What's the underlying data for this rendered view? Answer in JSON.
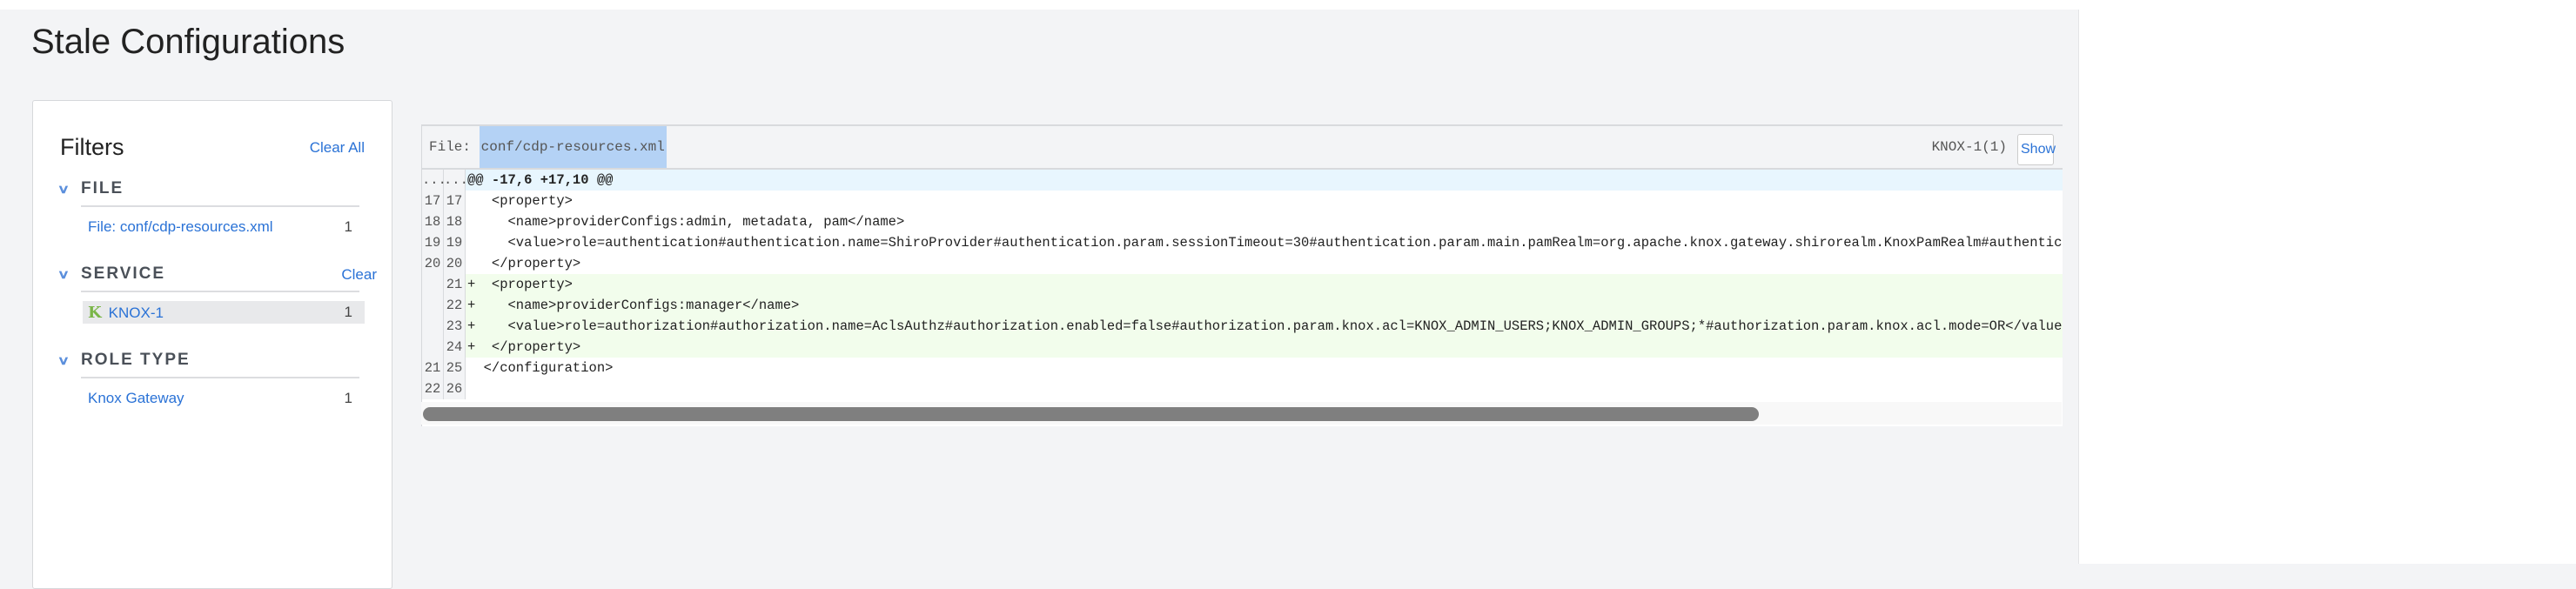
{
  "page": {
    "title": "Stale Configurations"
  },
  "filters": {
    "heading": "Filters",
    "clear_all": "Clear All",
    "sections": [
      {
        "title": "FILE",
        "items": [
          {
            "label": "File: conf/cdp-resources.xml",
            "count": "1"
          }
        ]
      },
      {
        "title": "SERVICE",
        "clear": "Clear",
        "items": [
          {
            "label": "KNOX-1",
            "count": "1",
            "icon": "knox-icon",
            "icon_text": "K"
          }
        ]
      },
      {
        "title": "ROLE TYPE",
        "items": [
          {
            "label": "Knox Gateway",
            "count": "1"
          }
        ]
      }
    ]
  },
  "diff": {
    "file_prefix": "File: ",
    "file_path": "conf/cdp-resources.xml",
    "service": "KNOX-1(1)",
    "show_label": "Show",
    "rows": [
      {
        "old": "...",
        "new": "...",
        "type": "hunk",
        "code": "@@ -17,6 +17,10 @@"
      },
      {
        "old": "17",
        "new": "17",
        "type": "ctx",
        "code": "   <property>"
      },
      {
        "old": "18",
        "new": "18",
        "type": "ctx",
        "code": "     <name>providerConfigs:admin, metadata, pam</name>"
      },
      {
        "old": "19",
        "new": "19",
        "type": "ctx",
        "code": "     <value>role=authentication#authentication.name=ShiroProvider#authentication.param.sessionTimeout=30#authentication.param.main.pamRealm=org.apache.knox.gateway.shirorealm.KnoxPamRealm#authentica"
      },
      {
        "old": "20",
        "new": "20",
        "type": "ctx",
        "code": "   </property>"
      },
      {
        "old": "",
        "new": "21",
        "type": "add",
        "code": "+  <property>"
      },
      {
        "old": "",
        "new": "22",
        "type": "add",
        "code": "+    <name>providerConfigs:manager</name>"
      },
      {
        "old": "",
        "new": "23",
        "type": "add",
        "code": "+    <value>role=authorization#authorization.name=AclsAuthz#authorization.enabled=false#authorization.param.knox.acl=KNOX_ADMIN_USERS;KNOX_ADMIN_GROUPS;*#authorization.param.knox.acl.mode=OR</value>"
      },
      {
        "old": "",
        "new": "24",
        "type": "add",
        "code": "+  </property>"
      },
      {
        "old": "21",
        "new": "25",
        "type": "ctx",
        "code": "  </configuration>"
      },
      {
        "old": "22",
        "new": "26",
        "type": "ctx",
        "code": ""
      }
    ]
  }
}
